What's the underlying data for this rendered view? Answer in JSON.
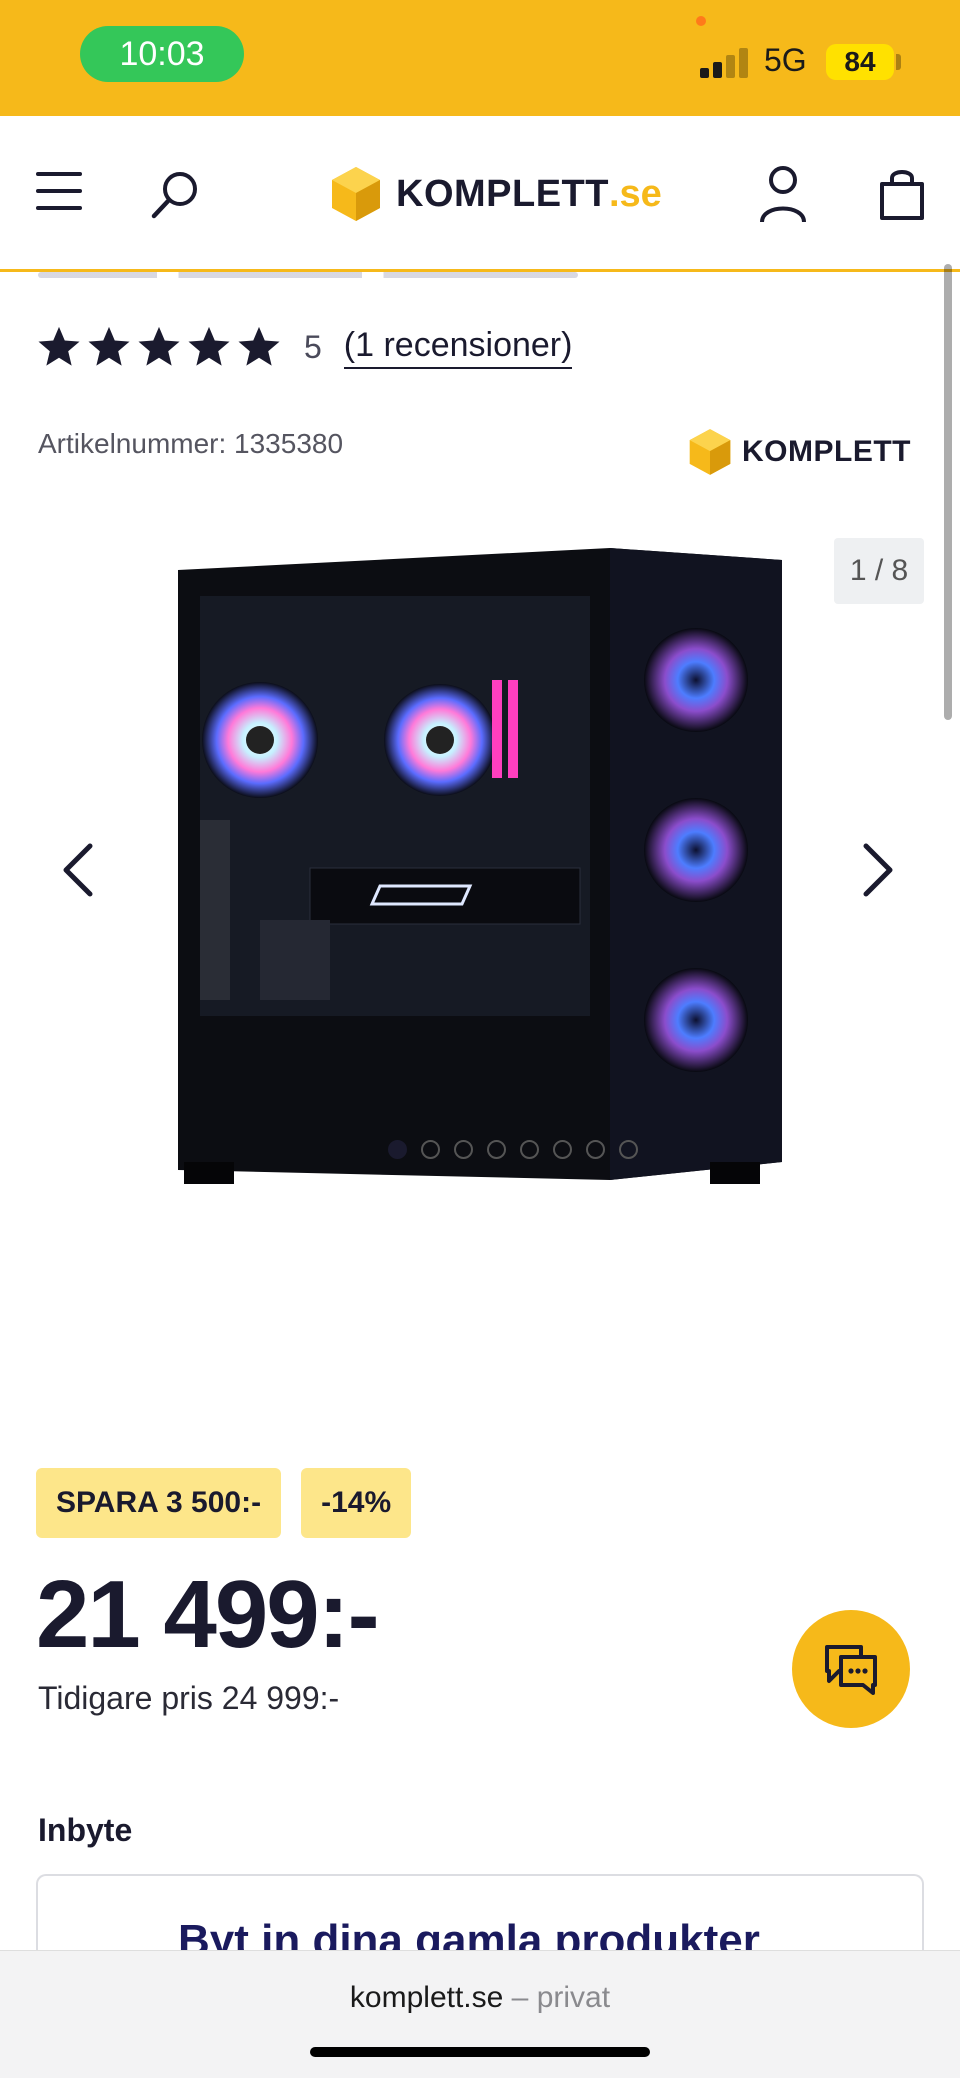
{
  "status_bar": {
    "time": "10:03",
    "network": "5G",
    "battery": "84",
    "background_color": "#f6b91a",
    "time_pill_color": "#34c759"
  },
  "header": {
    "menu_icon": "hamburger-menu-icon",
    "search_icon": "search-icon",
    "logo_name": "KOMPLETT",
    "logo_suffix": ".se",
    "account_icon": "user-icon",
    "cart_icon": "shopping-bag-icon",
    "accent_color": "#f6b91a"
  },
  "product": {
    "rating_value": "5",
    "rating_stars": 5,
    "reviews_link": "(1 recensioner)",
    "article_number": "Artikelnummer: 1335380",
    "brand_logo": "KOMPLETT",
    "image_counter": "1 / 8",
    "image_count": 8,
    "active_image": 1
  },
  "pricing": {
    "savings_badge": "SPARA 3 500:-",
    "discount_badge": "-14%",
    "price": "21 499:-",
    "previous_price": "Tidigare pris 24 999:-",
    "badge_color": "#fde68a"
  },
  "chat": {
    "icon": "chat-bubbles-icon"
  },
  "trade_in": {
    "label": "Inbyte",
    "card_title": "Byt in dina gamla produkter"
  },
  "browser": {
    "domain": "komplett.se",
    "suffix": "– privat"
  }
}
